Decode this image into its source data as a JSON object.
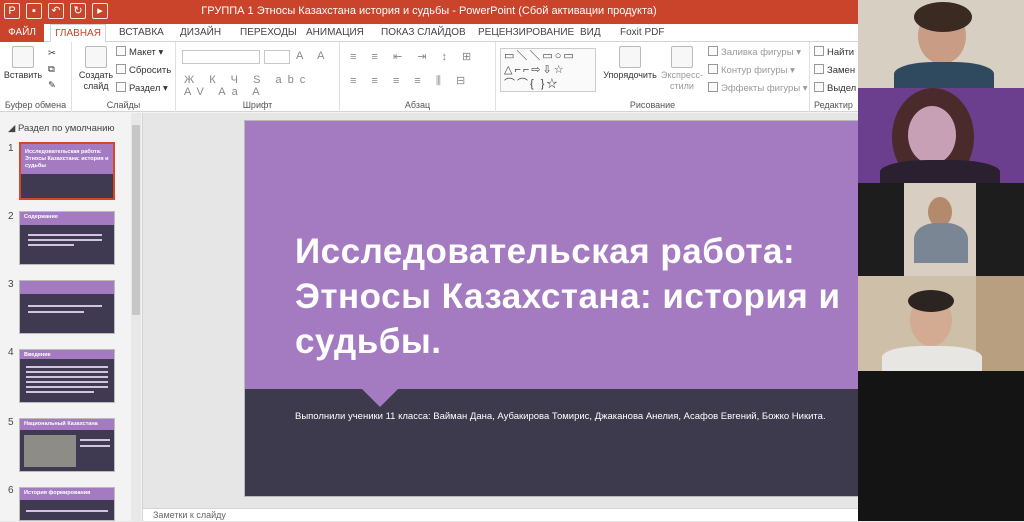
{
  "titlebar": {
    "title": "ГРУППА 1 Этносы Казахстана история и судьбы -  PowerPoint (Сбой активации продукта)"
  },
  "tabs": [
    {
      "label": "ФАЙЛ"
    },
    {
      "label": "ГЛАВНАЯ"
    },
    {
      "label": "ВСТАВКА"
    },
    {
      "label": "ДИЗАЙН"
    },
    {
      "label": "ПЕРЕХОДЫ"
    },
    {
      "label": "АНИМАЦИЯ"
    },
    {
      "label": "ПОКАЗ СЛАЙДОВ"
    },
    {
      "label": "РЕЦЕНЗИРОВАНИЕ"
    },
    {
      "label": "ВИД"
    },
    {
      "label": "Foxit PDF"
    }
  ],
  "ribbon": {
    "paste": "Вставить",
    "clipboard_group": "Буфер обмена",
    "create_slide": "Создать слайд",
    "layout": "Макет",
    "reset": "Сбросить",
    "section": "Раздел",
    "slides_group": "Слайды",
    "font_group": "Шрифт",
    "paragraph_group": "Абзац",
    "arrange": "Упорядочить",
    "quick_styles": "Экспресс-стили",
    "fill": "Заливка фигуры",
    "outline": "Контур фигуры",
    "effects": "Эффекты фигуры",
    "drawing_group": "Рисование",
    "find": "Найти",
    "replace": "Замен",
    "select": "Выдел",
    "editing_group": "Редактир"
  },
  "slide_panel": {
    "section_label": "Раздел по умолчанию",
    "slides": [
      {
        "number": "1",
        "title": "Исследовательская работа: Этносы Казахстана: история и судьбы"
      },
      {
        "number": "2",
        "title": "Содержание"
      },
      {
        "number": "3",
        "title": ""
      },
      {
        "number": "4",
        "title": "Введение"
      },
      {
        "number": "5",
        "title": "Национальный Казахстана"
      },
      {
        "number": "6",
        "title": "История формирования"
      }
    ]
  },
  "slide": {
    "title": "Исследовательская работа: Этносы Казахстана: история и судьбы.",
    "subtitle": "Выполнили ученики 11 класса: Вайман Дана, Аубакирова Томирис, Джаканова Анелия, Асафов Евгений, Божко Никита."
  },
  "notes": {
    "label": "Заметки к слайду"
  },
  "colors": {
    "accent": "#c9442b",
    "slide_purple": "#a47bc1",
    "slide_dark": "#3d3a4d"
  }
}
